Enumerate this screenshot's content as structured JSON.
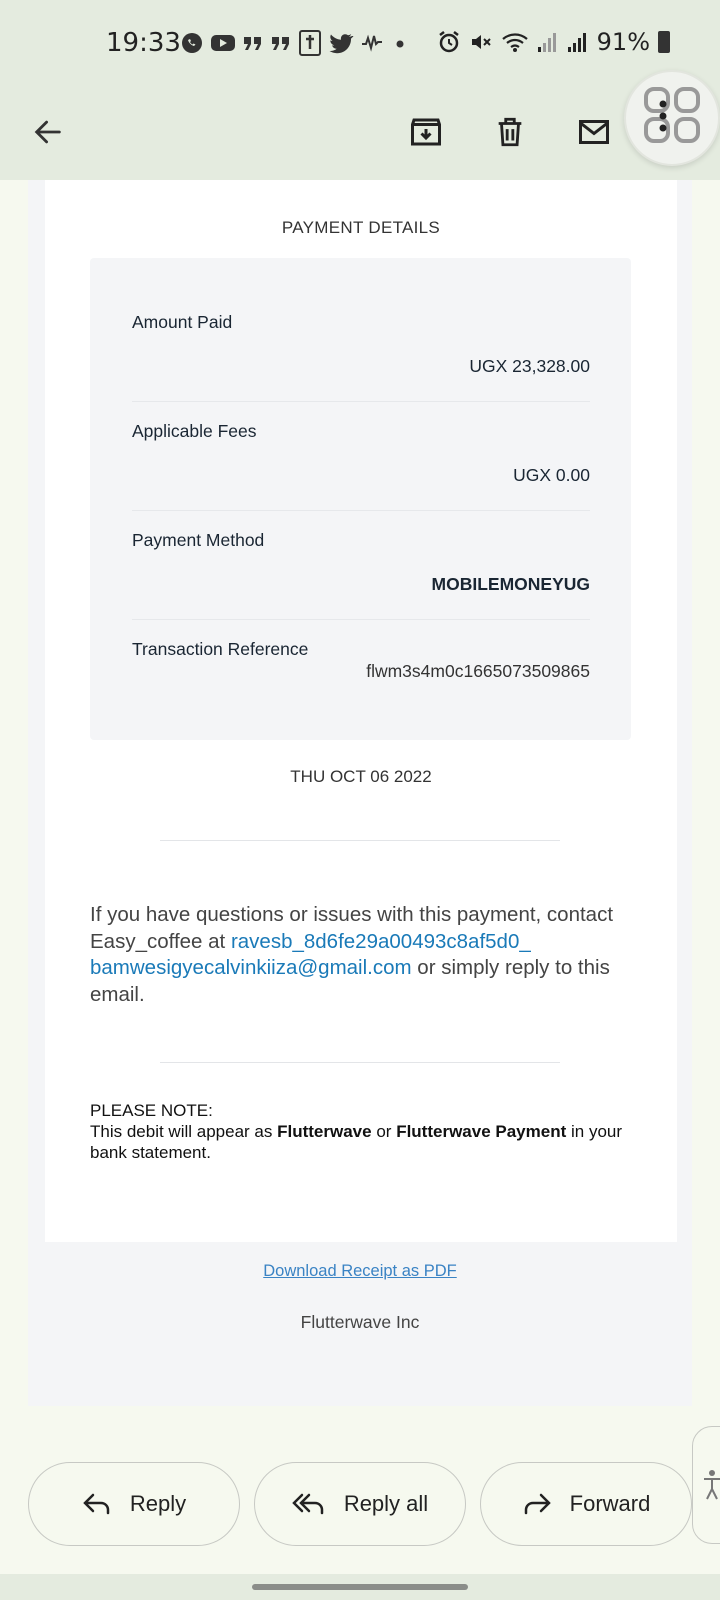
{
  "status_bar": {
    "time": "19:33",
    "battery": "91%",
    "icons": [
      "whatsapp-icon",
      "youtube-icon",
      "quote-icon",
      "quote-icon",
      "bible-icon",
      "twitter-icon",
      "waveform-icon",
      "dot-icon",
      "alarm-icon",
      "mute-icon",
      "wifi-icon",
      "signal-icon",
      "signal-icon",
      "battery-icon"
    ]
  },
  "toolbar": {
    "back": "back-arrow-icon",
    "archive": "archive-icon",
    "delete": "delete-icon",
    "mark_unread": "mail-icon",
    "more": "more-vert-icon"
  },
  "email": {
    "section_title": "PAYMENT DETAILS",
    "rows": [
      {
        "label": "Amount Paid",
        "value": "UGX 23,328.00"
      },
      {
        "label": "Applicable Fees",
        "value": "UGX 0.00"
      },
      {
        "label": "Payment Method",
        "value": "MOBILEMONEYUG"
      },
      {
        "label": "Transaction Reference",
        "value": "flwm3s4m0c1665073509865"
      }
    ],
    "date": "THU OCT 06 2022",
    "contact_prefix": "If you have questions or issues with this payment, contact Easy_coffee at",
    "contact_email": "ravesb_8d6fe29a00493c8af5d0_ bamwesigyecalvinkiiza@gmail.com",
    "contact_suffix": "or simply reply to this email.",
    "note_heading": "PLEASE NOTE:",
    "note_text_1": "This debit will appear as",
    "note_bold_1": "Flutterwave",
    "note_or": "or",
    "note_bold_2": "Flutterwave Payment",
    "note_text_2": "in your bank statement.",
    "download_link": "Download Receipt as PDF",
    "company": "Flutterwave Inc"
  },
  "actions": {
    "reply": "Reply",
    "reply_all": "Reply all",
    "forward": "Forward"
  }
}
